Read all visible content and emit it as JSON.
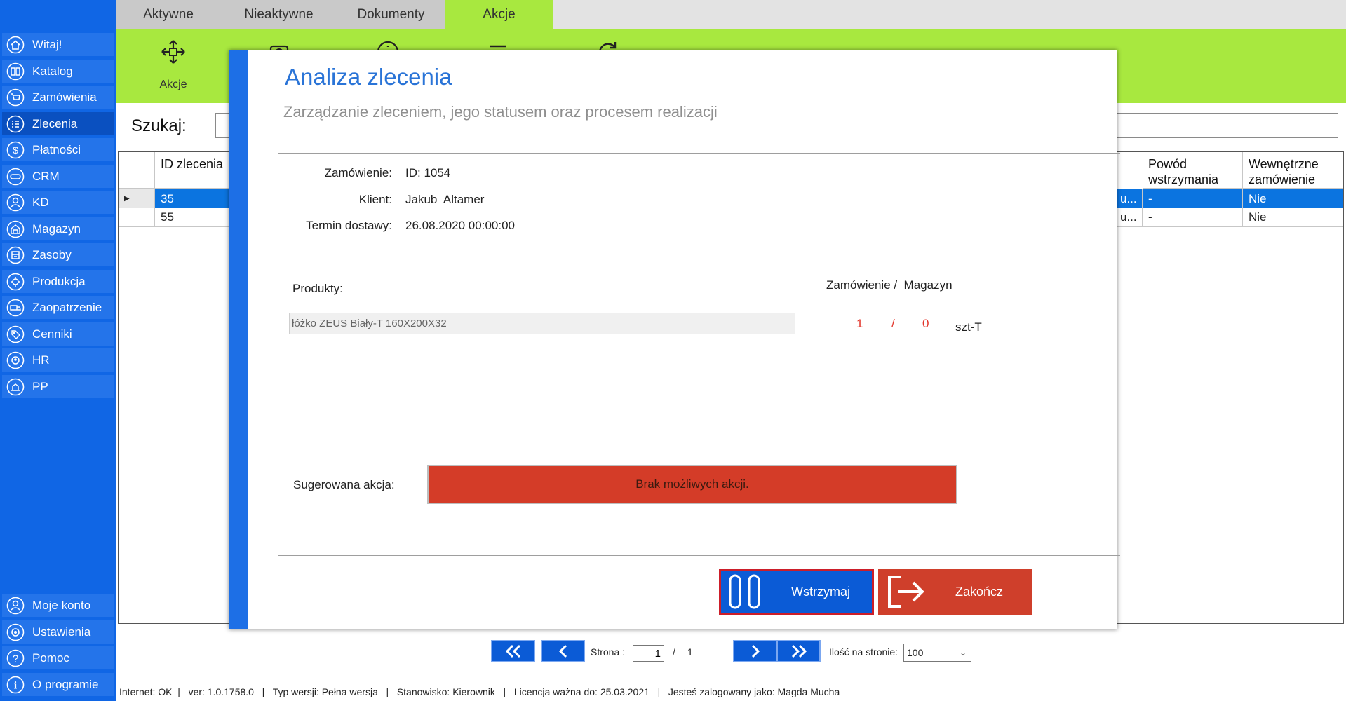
{
  "sidebar": {
    "items": [
      {
        "label": "Witaj!",
        "icon": "home-icon"
      },
      {
        "label": "Katalog",
        "icon": "book-icon"
      },
      {
        "label": "Zamówienia",
        "icon": "cart-icon"
      },
      {
        "label": "Zlecenia",
        "icon": "list-icon"
      },
      {
        "label": "Płatności",
        "icon": "dollar-icon"
      },
      {
        "label": "CRM",
        "icon": "crm-icon"
      },
      {
        "label": "KD",
        "icon": "person-icon"
      },
      {
        "label": "Magazyn",
        "icon": "warehouse-icon"
      },
      {
        "label": "Zasoby",
        "icon": "box-icon"
      },
      {
        "label": "Produkcja",
        "icon": "factory-icon"
      },
      {
        "label": "Zaopatrzenie",
        "icon": "truck-icon"
      },
      {
        "label": "Cenniki",
        "icon": "tag-icon"
      },
      {
        "label": "HR",
        "icon": "hr-icon"
      },
      {
        "label": "PP",
        "icon": "pp-icon"
      }
    ],
    "bottom_items": [
      {
        "label": "Moje konto",
        "icon": "account-icon"
      },
      {
        "label": "Ustawienia",
        "icon": "settings-icon"
      },
      {
        "label": "Pomoc",
        "icon": "help-icon"
      },
      {
        "label": "O programie",
        "icon": "info-icon"
      }
    ]
  },
  "tabs": [
    {
      "label": "Aktywne"
    },
    {
      "label": "Nieaktywne"
    },
    {
      "label": "Dokumenty"
    },
    {
      "label": "Akcje"
    }
  ],
  "ribbon": {
    "actions_label": "Akcje"
  },
  "search": {
    "label": "Szukaj:",
    "value": ""
  },
  "grid": {
    "headers": {
      "id": "ID zlecenia",
      "reason": "Powód wstrzymania",
      "internal": "Wewnętrzne zamówienie"
    },
    "rows": [
      {
        "id": "35",
        "partial": "u...",
        "reason": "-",
        "internal": "Nie"
      },
      {
        "id": "55",
        "partial": "u...",
        "reason": "-",
        "internal": "Nie"
      }
    ]
  },
  "pager": {
    "page_label": "Strona :",
    "current_page": "1",
    "separator": "/",
    "total_pages": "1",
    "per_page_label": "Ilość na stronie:",
    "per_page_value": "100"
  },
  "statusbar": {
    "text": "Internet: OK  |   ver: 1.0.1758.0   |   Typ wersji: Pełna wersja   |   Stanowisko: Kierownik   |   Licencja ważna do: 25.03.2021   |   Jesteś zalogowany jako: Magda Mucha"
  },
  "dialog": {
    "title": "Analiza zlecenia",
    "subtitle": "Zarządzanie zleceniem, jego statusem oraz procesem realizacji",
    "order_label": "Zamówienie:",
    "order_value": "ID: 1054",
    "client_label": "Klient:",
    "client_value": "Jakub  Altamer",
    "delivery_label": "Termin dostawy:",
    "delivery_value": "26.08.2020 00:00:00",
    "products_label": "Produkty:",
    "qty_header": "Zamówienie /  Magazyn",
    "product_name": "łóżko ZEUS Biały-T 160X200X32",
    "ordered_qty": "1",
    "qty_separator": "/",
    "stock_qty": "0",
    "unit": "szt-T",
    "suggested_label": "Sugerowana akcja:",
    "suggested_action": "Brak możliwych akcji.",
    "hold_button": "Wstrzymaj",
    "end_button": "Zakończ"
  },
  "colors": {
    "sidebar": "#1066e5",
    "ribbon": "#a8e83f",
    "dialog_accent": "#1d6fe6",
    "danger": "#d43c28",
    "selection": "#0b74e0"
  }
}
